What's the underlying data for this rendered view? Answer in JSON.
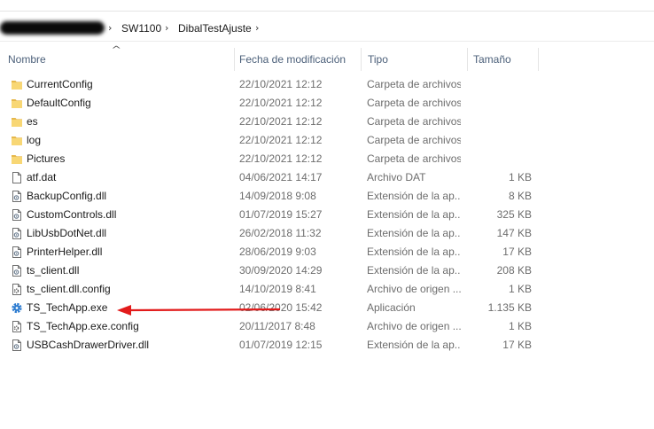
{
  "breadcrumb": {
    "items": [
      "SW1100",
      "DibalTestAjuste"
    ],
    "separator": "›"
  },
  "columns": {
    "name": "Nombre",
    "date": "Fecha de modificación",
    "type": "Tipo",
    "size": "Tamaño"
  },
  "files": [
    {
      "name": "CurrentConfig",
      "date": "22/10/2021 12:12",
      "type": "Carpeta de archivos",
      "size": "",
      "icon": "folder-icon"
    },
    {
      "name": "DefaultConfig",
      "date": "22/10/2021 12:12",
      "type": "Carpeta de archivos",
      "size": "",
      "icon": "folder-icon"
    },
    {
      "name": "es",
      "date": "22/10/2021 12:12",
      "type": "Carpeta de archivos",
      "size": "",
      "icon": "folder-icon"
    },
    {
      "name": "log",
      "date": "22/10/2021 12:12",
      "type": "Carpeta de archivos",
      "size": "",
      "icon": "folder-icon"
    },
    {
      "name": "Pictures",
      "date": "22/10/2021 12:12",
      "type": "Carpeta de archivos",
      "size": "",
      "icon": "folder-icon"
    },
    {
      "name": "atf.dat",
      "date": "04/06/2021 14:17",
      "type": "Archivo DAT",
      "size": "1 KB",
      "icon": "file-icon"
    },
    {
      "name": "BackupConfig.dll",
      "date": "14/09/2018 9:08",
      "type": "Extensión de la ap...",
      "size": "8 KB",
      "icon": "dll-file-icon"
    },
    {
      "name": "CustomControls.dll",
      "date": "01/07/2019 15:27",
      "type": "Extensión de la ap...",
      "size": "325 KB",
      "icon": "dll-file-icon"
    },
    {
      "name": "LibUsbDotNet.dll",
      "date": "26/02/2018 11:32",
      "type": "Extensión de la ap...",
      "size": "147 KB",
      "icon": "dll-file-icon"
    },
    {
      "name": "PrinterHelper.dll",
      "date": "28/06/2019 9:03",
      "type": "Extensión de la ap...",
      "size": "17 KB",
      "icon": "dll-file-icon"
    },
    {
      "name": "ts_client.dll",
      "date": "30/09/2020 14:29",
      "type": "Extensión de la ap...",
      "size": "208 KB",
      "icon": "dll-file-icon"
    },
    {
      "name": "ts_client.dll.config",
      "date": "14/10/2019 8:41",
      "type": "Archivo de origen ...",
      "size": "1 KB",
      "icon": "config-file-icon"
    },
    {
      "name": "TS_TechApp.exe",
      "date": "02/06/2020 15:42",
      "type": "Aplicación",
      "size": "1.135 KB",
      "icon": "gear-icon"
    },
    {
      "name": "TS_TechApp.exe.config",
      "date": "20/11/2017 8:48",
      "type": "Archivo de origen ...",
      "size": "1 KB",
      "icon": "config-file-icon"
    },
    {
      "name": "USBCashDrawerDriver.dll",
      "date": "01/07/2019 12:15",
      "type": "Extensión de la ap...",
      "size": "17 KB",
      "icon": "dll-file-icon"
    }
  ],
  "colors": {
    "folder": "#f8d775",
    "folder_dark": "#e6b84c",
    "header_text": "#4c607a",
    "annotation_arrow": "#e21b1b",
    "gear": "#2b7bd0"
  }
}
